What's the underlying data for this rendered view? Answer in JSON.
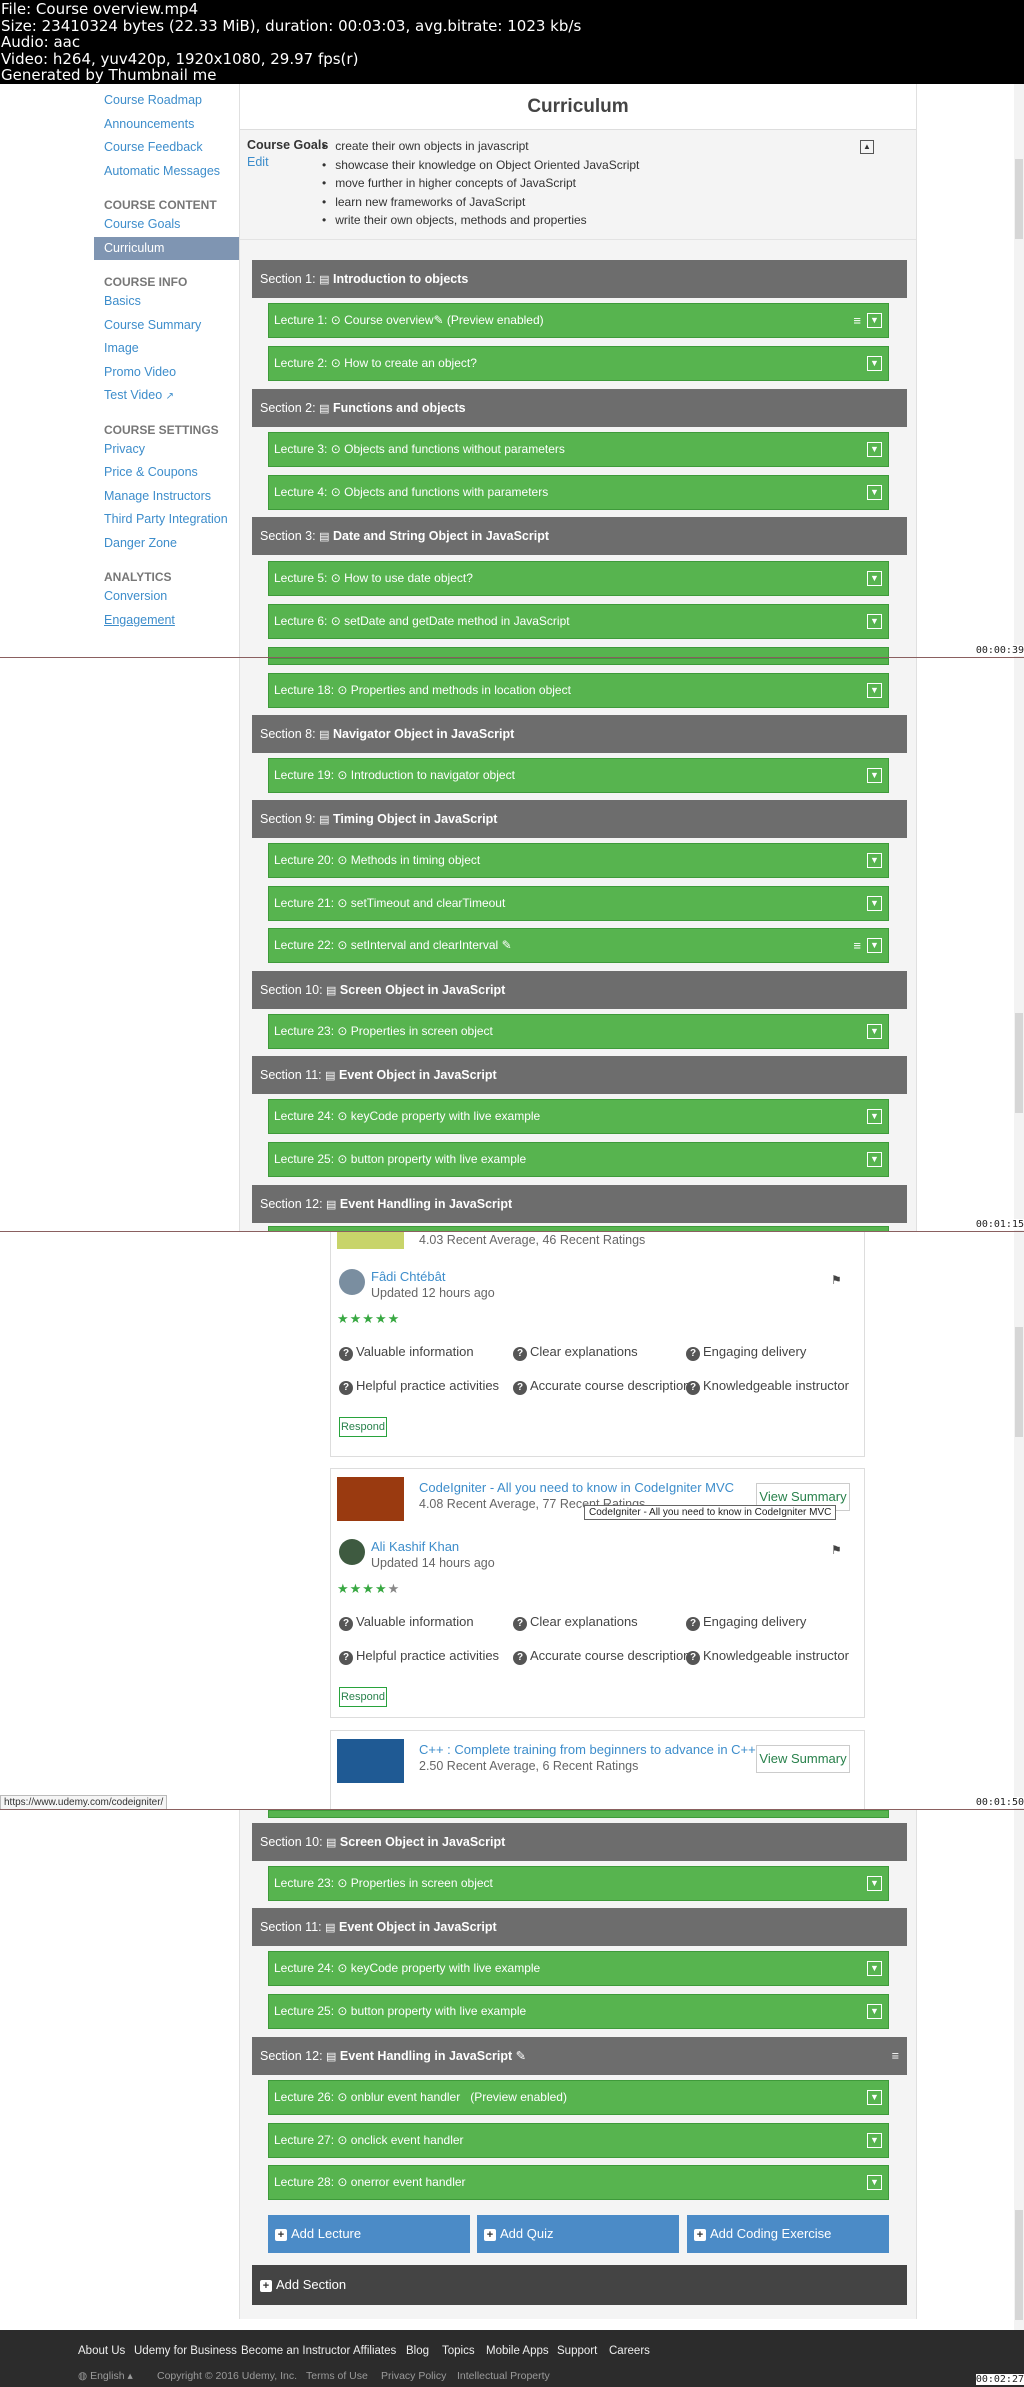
{
  "meta": {
    "line1": "File: Course overview.mp4",
    "line2": "Size: 23410324 bytes (22.33 MiB), duration: 00:03:03, avg.bitrate: 1023 kb/s",
    "line3": "Audio: aac",
    "line4": "Video: h264, yuv420p, 1920x1080, 29.97 fps(r)",
    "line5": "Generated by Thumbnail me"
  },
  "stamps": [
    "00:00:39",
    "00:01:15",
    "00:01:50",
    "00:02:27"
  ],
  "sidebar": {
    "top_links": [
      "Course Roadmap",
      "Announcements",
      "Course Feedback",
      "Automatic Messages"
    ],
    "content_head": "COURSE CONTENT",
    "content_links": [
      "Course Goals",
      "Curriculum"
    ],
    "info_head": "COURSE INFO",
    "info_links": [
      "Basics",
      "Course Summary",
      "Image",
      "Promo Video",
      "Test Video"
    ],
    "settings_head": "COURSE SETTINGS",
    "settings_links": [
      "Privacy",
      "Price & Coupons",
      "Manage Instructors",
      "Third Party Integration",
      "Danger Zone"
    ],
    "analytics_head": "ANALYTICS",
    "analytics_links": [
      "Conversion",
      "Engagement"
    ]
  },
  "curriculum": {
    "title": "Curriculum",
    "goals_label": "Course Goals",
    "goals_edit": "Edit",
    "goals": [
      "create their own objects in javascript",
      "showcase their knowledge on Object Oriented JavaScript",
      "move further in higher concepts of JavaScript",
      "learn new frameworks of JavaScript",
      "write their own objects, methods and properties"
    ]
  },
  "frame1": {
    "sections": [
      {
        "prefix": "Section 1:",
        "title": "Introduction to objects"
      },
      {
        "prefix": "Section 2:",
        "title": "Functions and objects"
      },
      {
        "prefix": "Section 3:",
        "title": "Date and String Object in JavaScript"
      }
    ],
    "lectures": [
      {
        "prefix": "Lecture 1:",
        "title": "Course overview",
        "extra": "(Preview enabled)"
      },
      {
        "prefix": "Lecture 2:",
        "title": "How to create an object?"
      },
      {
        "prefix": "Lecture 3:",
        "title": "Objects and functions without parameters"
      },
      {
        "prefix": "Lecture 4:",
        "title": "Objects and functions with parameters"
      },
      {
        "prefix": "Lecture 5:",
        "title": "How to use date object?"
      },
      {
        "prefix": "Lecture 6:",
        "title": "setDate and getDate method in JavaScript"
      }
    ]
  },
  "frame2": {
    "sections": [
      {
        "prefix": "Section 8:",
        "title": "Navigator Object in JavaScript"
      },
      {
        "prefix": "Section 9:",
        "title": "Timing Object in JavaScript"
      },
      {
        "prefix": "Section 10:",
        "title": "Screen Object in JavaScript"
      },
      {
        "prefix": "Section 11:",
        "title": "Event Object in JavaScript"
      },
      {
        "prefix": "Section 12:",
        "title": "Event Handling in JavaScript"
      }
    ],
    "lectures": [
      {
        "prefix": "Lecture 18:",
        "title": "Properties and methods in location object"
      },
      {
        "prefix": "Lecture 19:",
        "title": "Introduction to navigator object"
      },
      {
        "prefix": "Lecture 20:",
        "title": "Methods in timing object"
      },
      {
        "prefix": "Lecture 21:",
        "title": "setTimeout and clearTimeout"
      },
      {
        "prefix": "Lecture 22:",
        "title": "setInterval and clearInterval"
      },
      {
        "prefix": "Lecture 23:",
        "title": "Properties in screen object"
      },
      {
        "prefix": "Lecture 24:",
        "title": "keyCode property with live example"
      },
      {
        "prefix": "Lecture 25:",
        "title": "button property with live example"
      }
    ]
  },
  "frame3": {
    "first_rating": "4.03 Recent Average, 46 Recent Ratings",
    "review1": {
      "name": "Fâdi Chtébât",
      "updated": "Updated 12 hours ago",
      "stars": "★★★★★"
    },
    "criteria": [
      "Valuable information",
      "Clear explanations",
      "Engaging delivery",
      "Helpful practice activities",
      "Accurate course description",
      "Knowledgeable instructor"
    ],
    "respond": "Respond",
    "course2": {
      "title": "CodeIgniter - All you need to know in CodeIgniter MVC",
      "rating": "4.08 Recent Average, 77 Recent Ratings",
      "tooltip": "CodeIgniter - All you need to know in CodeIgniter MVC"
    },
    "review2": {
      "name": "Ali Kashif Khan",
      "updated": "Updated 14 hours ago",
      "stars": "★★★★",
      "star_off": "★"
    },
    "course3": {
      "title": "C++ : Complete training from beginners to advance in C++",
      "rating": "2.50 Recent Average, 6 Recent Ratings"
    },
    "view_summary": "View Summary",
    "url": "https://www.udemy.com/codeigniter/"
  },
  "frame4": {
    "sections": [
      {
        "prefix": "Section 10:",
        "title": "Screen Object in JavaScript"
      },
      {
        "prefix": "Section 11:",
        "title": "Event Object in JavaScript"
      },
      {
        "prefix": "Section 12:",
        "title": "Event Handling in JavaScript"
      }
    ],
    "lectures": [
      {
        "prefix": "Lecture 23:",
        "title": "Properties in screen object"
      },
      {
        "prefix": "Lecture 24:",
        "title": "keyCode property with live example"
      },
      {
        "prefix": "Lecture 25:",
        "title": "button property with live example"
      },
      {
        "prefix": "Lecture 26:",
        "title": "onblur event handler",
        "extra": "(Preview enabled)"
      },
      {
        "prefix": "Lecture 27:",
        "title": "onclick event handler"
      },
      {
        "prefix": "Lecture 28:",
        "title": "onerror event handler"
      }
    ],
    "add_lecture": "Add Lecture",
    "add_quiz": "Add Quiz",
    "add_coding": "Add Coding Exercise",
    "add_section": "Add Section"
  },
  "footer": {
    "links": [
      "About Us",
      "Udemy for Business",
      "Become an Instructor",
      "Affiliates",
      "Blog",
      "Topics",
      "Mobile Apps",
      "Support",
      "Careers"
    ],
    "language": "English",
    "copyright": "Copyright © 2016 Udemy, Inc.",
    "terms": "Terms of Use",
    "privacy": "Privacy Policy",
    "ip": "Intellectual Property"
  }
}
